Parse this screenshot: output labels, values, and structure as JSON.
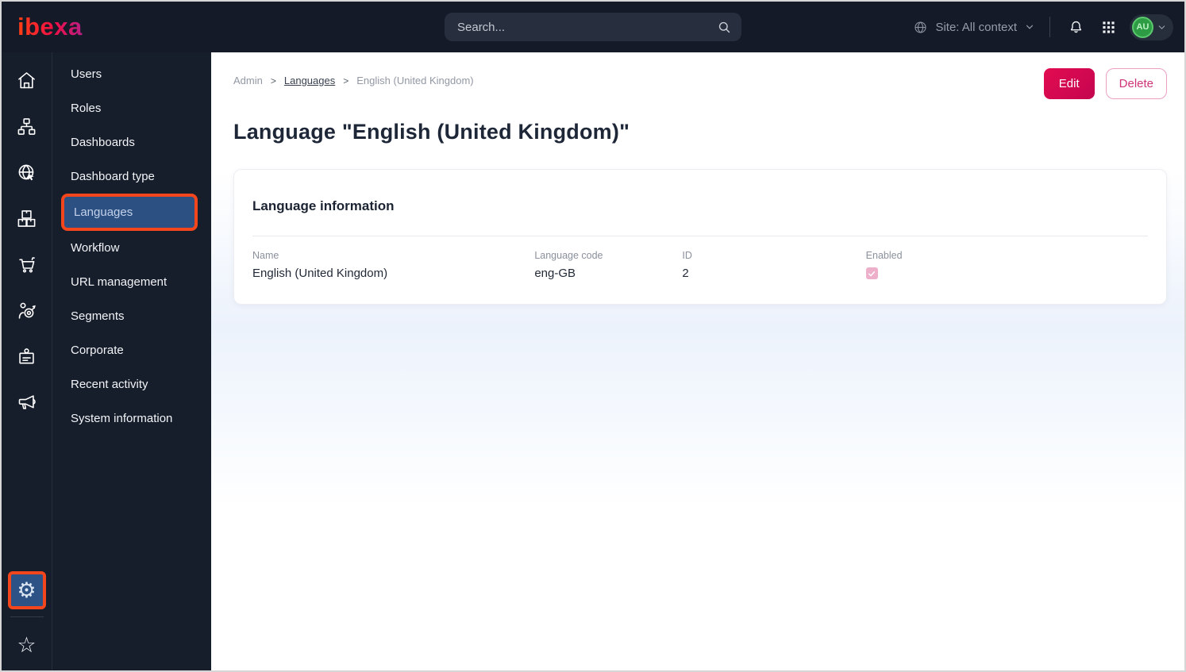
{
  "topbar": {
    "logo_text": "ibexa",
    "search_placeholder": "Search...",
    "site_context_label": "Site: All context",
    "avatar_initials": "AU"
  },
  "nav_rail": {
    "items": [
      {
        "icon": "home-icon"
      },
      {
        "icon": "sitemap-icon"
      },
      {
        "icon": "globe-pointer-icon"
      },
      {
        "icon": "products-icon"
      },
      {
        "icon": "cart-icon"
      },
      {
        "icon": "audience-target-icon"
      },
      {
        "icon": "badge-icon"
      },
      {
        "icon": "megaphone-icon"
      }
    ],
    "bottom": [
      {
        "icon": "gear-icon",
        "highlighted": true
      },
      {
        "icon": "star-icon"
      }
    ]
  },
  "sidebar": {
    "items": [
      {
        "label": "Users"
      },
      {
        "label": "Roles"
      },
      {
        "label": "Dashboards"
      },
      {
        "label": "Dashboard type"
      },
      {
        "label": "Languages",
        "selected": true
      },
      {
        "label": "Workflow"
      },
      {
        "label": "URL management"
      },
      {
        "label": "Segments"
      },
      {
        "label": "Corporate"
      },
      {
        "label": "Recent activity"
      },
      {
        "label": "System information"
      }
    ]
  },
  "breadcrumb": {
    "items": [
      {
        "label": "Admin"
      },
      {
        "label": "Languages"
      },
      {
        "label": "English (United Kingdom)"
      }
    ]
  },
  "actions": {
    "edit_label": "Edit",
    "delete_label": "Delete"
  },
  "page": {
    "title": "Language \"English (United Kingdom)\""
  },
  "card": {
    "title": "Language information",
    "fields": [
      {
        "label": "Name",
        "value": "English (United Kingdom)"
      },
      {
        "label": "Language code",
        "value": "eng-GB"
      },
      {
        "label": "ID",
        "value": "2"
      },
      {
        "label": "Enabled",
        "value": "checked"
      }
    ],
    "enabled": true
  },
  "colors": {
    "topbar_bg": "#141a27",
    "sidebar_bg": "#161d2b",
    "annotation_orange": "#f4461c",
    "selected_blue": "#2d5082",
    "primary_pink": "#d80a4d",
    "checkbox_pink": "#eeafca",
    "avatar_green": "#2e9c45"
  }
}
